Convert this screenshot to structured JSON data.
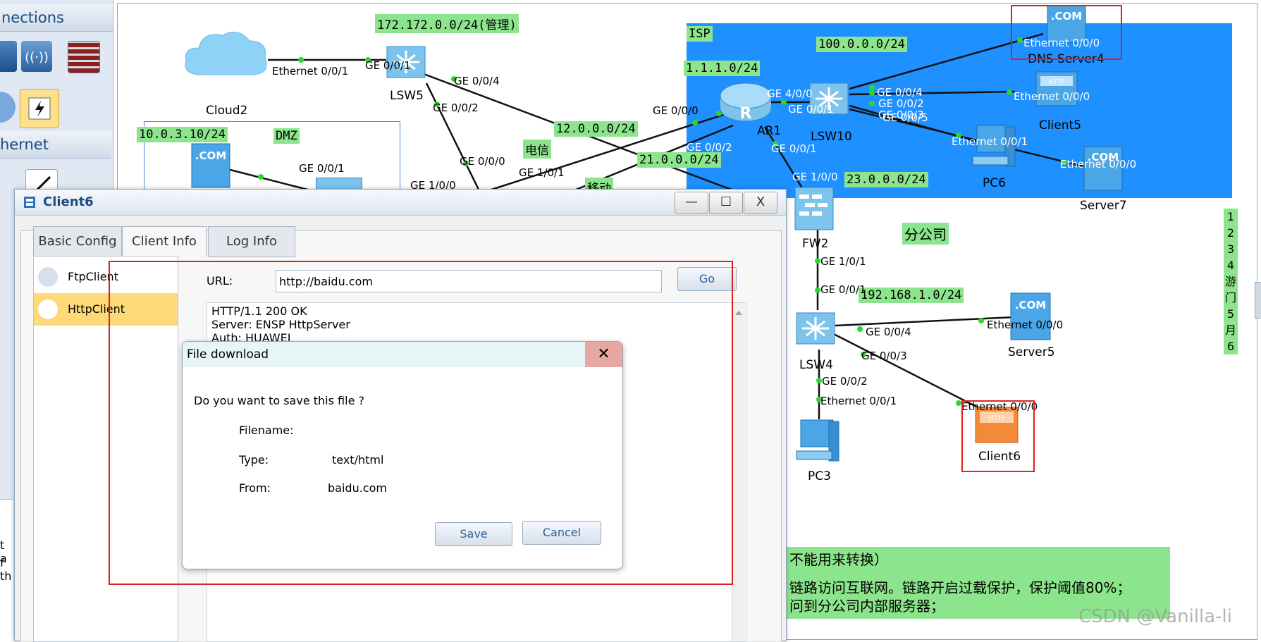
{
  "palette": {
    "connections_label": "nections",
    "ethernet_label": "hernet",
    "partial_text_1": "t a",
    "partial_text_2": "f th"
  },
  "topology": {
    "clouds": [
      {
        "name": "Cloud2"
      }
    ],
    "switch_names": {
      "lsw5": "LSW5",
      "lsw10": "LSW10",
      "lsw4": "LSW4"
    },
    "router_name": "AR1",
    "router_glyph": "R",
    "firewall_name": "FW2",
    "hosts": {
      "client5": "Client5",
      "pc6": "PC6",
      "server7": "Server7",
      "server5": "Server5",
      "client6": "Client6",
      "pc3": "PC3",
      "dns_server4": "DNS Server4"
    },
    "network_labels": {
      "mgmt": "172.172.0.0/24(管理)",
      "dmz_net": "10.0.3.10/24",
      "dmz": "DMZ",
      "isp": "ISP",
      "net100": "100.0.0.0/24",
      "net111": "1.1.1.0/24",
      "net12": "12.0.0.0/24",
      "telecom": "电信",
      "net21": "21.0.0.0/24",
      "mobile": "移动",
      "net23": "23.0.0.0/24",
      "branch": "分公司",
      "net192": "192.168.1.0/24"
    },
    "port_labels": {
      "eth001_cloud": "Ethernet 0/0/1",
      "ge001_lsw5": "GE 0/0/1",
      "ge004_lsw5": "GE 0/0/4",
      "ge002_lsw5": "GE 0/0/2",
      "ge001_dmz": "GE 0/0/1",
      "ge000_core": "GE 0/0/0",
      "ge101_core": "GE 1/0/1",
      "ge100_core": "GE 1/0/0",
      "ge000_ar1": "GE 0/0/0",
      "ge400_ar1": "GE 4/0/0",
      "ge002_ar1": "GE 0/0/2",
      "ge001_ar1": "GE 0/0/1",
      "ge001_lsw10": "GE 0/0/1",
      "ge004_lsw10": "GE 0/0/4",
      "ge002_lsw10": "GE 0/0/2",
      "ge003_lsw10": "GE 0/0/3",
      "ge005_lsw10": "GE 0/0/5",
      "eth000_dns": "Ethernet 0/0/0",
      "eth000_client5": "Ethernet 0/0/0",
      "eth001_pc6": "Ethernet 0/0/1",
      "eth000_server7": "Ethernet 0/0/0",
      "ge100_fw2": "GE 1/0/0",
      "ge101_fw2": "GE 1/0/1",
      "ge001_lsw4": "GE 0/0/1",
      "ge004_lsw4": "GE 0/0/4",
      "ge003_lsw4": "GE 0/0/3",
      "ge002_lsw4": "GE 0/0/2",
      "eth001_pc3": "Ethernet 0/0/1",
      "eth000_server5": "Ethernet 0/0/0",
      "eth000_client6": "Ethernet 0/0/0"
    },
    "device_icon_text": {
      "com": ".COM",
      "http": "HTTP"
    },
    "vertical_note": [
      "1",
      "2",
      "3",
      "4",
      "游",
      "门",
      "5",
      "月",
      "6"
    ],
    "requirements_lines": [
      "不能用来转换）",
      "链路访问互联网。链路开启过载保护，保护阈值80%；",
      "问到分公司内部服务器；"
    ],
    "watermark": "CSDN @Vanilla-li"
  },
  "client_window": {
    "title": "Client6",
    "controls": {
      "minimize": "—",
      "maximize": "☐",
      "close": "X"
    },
    "tabs": [
      "Basic Config",
      "Client Info",
      "Log Info"
    ],
    "sidebar_items": [
      "FtpClient",
      "HttpClient"
    ],
    "url_label": "URL:",
    "url_value": "http://baidu.com",
    "go_label": "Go",
    "response_lines": [
      "HTTP/1.1 200 OK",
      "Server: ENSP HttpServer",
      "Auth: HUAWEI"
    ]
  },
  "dialog": {
    "title": "File download",
    "close_glyph": "✕",
    "question": "Do you want to save this file ?",
    "filename_label": "Filename:",
    "filename_value": "",
    "type_label": "Type:",
    "type_value": "text/html",
    "from_label": "From:",
    "from_value": "baidu.com",
    "save_label": "Save",
    "cancel_label": "Cancel"
  }
}
